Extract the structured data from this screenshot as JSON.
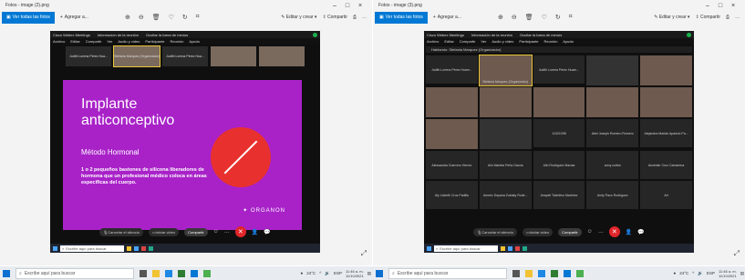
{
  "left_window": {
    "title": "Fotos - image (2).png",
    "toolbar": {
      "see_all": "Ver todas las fotos",
      "add": "Agregar a...",
      "edit": "Editar y crear",
      "share": "Compartir"
    },
    "webex": {
      "app": "Cisco Webex Meetings",
      "info": "Información de la reunión",
      "hide": "Ocultar la barra de menús",
      "menu": [
        "Archivo",
        "Editar",
        "Compartir",
        "Ver",
        "Audio y video",
        "Participante",
        "Reunión",
        "Ayuda"
      ],
      "thumbnails": [
        {
          "label": "Judith Lorena Pérez Hua...",
          "kind": "name"
        },
        {
          "label": "Stefania Marquez (Organizador)",
          "kind": "face-selected"
        },
        {
          "label": "Judith Lorena Pérez Hua...",
          "kind": "name"
        },
        {
          "label": "",
          "kind": "face"
        },
        {
          "label": "",
          "kind": "face"
        }
      ],
      "slide": {
        "title": "Implante anticonceptivo",
        "subtitle": "Método Hormonal",
        "body": "1 o 2 pequeños bastones de silicona liberadores de hormona que un profesional médico coloca en áreas específicas del cuerpo.",
        "logo": "ORGANON"
      },
      "controls": [
        "Cancelar el silencio",
        "Iniciar video",
        "Compartir"
      ],
      "taskbar_search": "Escribe aquí para buscar"
    }
  },
  "right_window": {
    "title": "Fotos - image (3).png",
    "toolbar": {
      "see_all": "Ver todas las fotos",
      "add": "Agregar a...",
      "edit": "Editar y crear",
      "share": "Compartir"
    },
    "webex": {
      "app": "Cisco Webex Meetings",
      "info": "Información de la reunión",
      "hide": "Ocultar la barra de menús",
      "menu": [
        "Archivo",
        "Editar",
        "Compartir",
        "Ver",
        "Audio y video",
        "Participante",
        "Reunión",
        "Ayuda"
      ],
      "speaking": "Hablando: Stefania Marquez (Organizador)",
      "tiles": [
        {
          "label": "Judith Lorena Pérez Huam...",
          "kind": "name"
        },
        {
          "label": "Stefania Marquez (Organizador)",
          "kind": "face-selected"
        },
        {
          "label": "Judith Lorena Pérez Huam...",
          "kind": "name"
        },
        {
          "label": "",
          "kind": "dark"
        },
        {
          "label": "",
          "kind": "face"
        },
        {
          "label": "",
          "kind": "face"
        },
        {
          "label": "",
          "kind": "face"
        },
        {
          "label": "",
          "kind": "face"
        },
        {
          "label": "",
          "kind": "face"
        },
        {
          "label": "",
          "kind": "face"
        },
        {
          "label": "",
          "kind": "face"
        },
        {
          "label": "",
          "kind": "dark"
        },
        {
          "label": "11021098",
          "kind": "name"
        },
        {
          "label": "Abel Joseph Romero Romero",
          "kind": "name"
        },
        {
          "label": "Alejandra Marián Aparicio Pa...",
          "kind": "name"
        },
        {
          "label": "Alessandra Guerrero Hermo",
          "kind": "name"
        },
        {
          "label": "Alin Mariela Peña Garcia",
          "kind": "name"
        },
        {
          "label": "Alin Rodriguez Macias",
          "kind": "name"
        },
        {
          "label": "anny cortes",
          "kind": "name"
        },
        {
          "label": "Asneider Cruz Camarena",
          "kind": "name"
        },
        {
          "label": "Aly Lisbeth Cruz Padilla",
          "kind": "name"
        },
        {
          "label": "Americ Dayana Zubiaty Rode...",
          "kind": "name"
        },
        {
          "label": "Anayeli Tolentino Martinez",
          "kind": "name"
        },
        {
          "label": "Andy Paco Rodriguez",
          "kind": "name"
        },
        {
          "label": "Art",
          "kind": "name"
        }
      ],
      "controls": [
        "Cancelar el silencio",
        "Iniciar video",
        "Compartir"
      ],
      "taskbar_search": "Escribe aquí para buscar"
    }
  },
  "os_taskbar": {
    "search": "Escribe aquí para buscar",
    "temp": "24°C",
    "lang": "ESP",
    "time": "11:46 a. m.",
    "date": "11/10/2021"
  }
}
